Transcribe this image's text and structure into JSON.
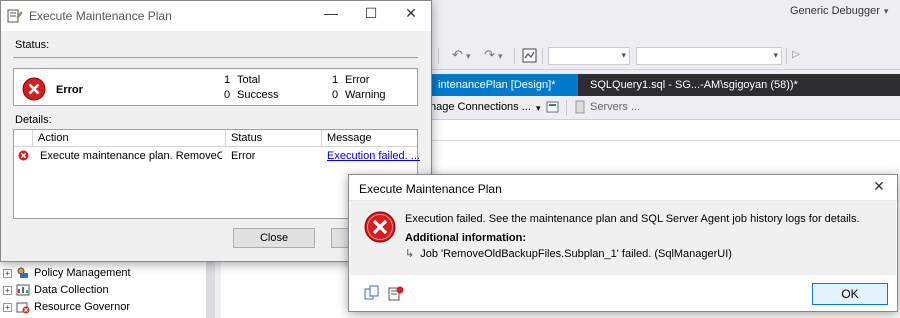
{
  "ssms": {
    "toolbar": {
      "undo_icon": "undo-icon",
      "redo_icon": "redo-icon",
      "debugger_label": "Generic Debugger"
    },
    "tabs": [
      {
        "label": "intenancePlan [Design]*"
      },
      {
        "label": "SQLQuery1.sql - SG...-AM\\sgigoyan (58))*"
      }
    ],
    "subtoolbar": {
      "manage_connections": "nage Connections ...",
      "servers": "Servers ..."
    },
    "tree": [
      {
        "label": "Policy Management",
        "icon": "policy-icon"
      },
      {
        "label": "Data Collection",
        "icon": "data-collection-icon"
      },
      {
        "label": "Resource Governor",
        "icon": "resource-governor-icon"
      }
    ],
    "colors": {
      "tab_bar": "#2d2d30",
      "tab_active": "#007acc"
    }
  },
  "execute_dialog": {
    "title": "Execute Maintenance Plan",
    "status_label": "Status:",
    "status": {
      "result": "Error",
      "total_count": "1",
      "total_label": "Total",
      "success_count": "0",
      "success_label": "Success",
      "error_count": "1",
      "error_label": "Error",
      "warning_count": "0",
      "warning_label": "Warning"
    },
    "details_label": "Details:",
    "columns": [
      "Action",
      "Status",
      "Message"
    ],
    "rows": [
      {
        "action": "Execute maintenance plan. RemoveOld...",
        "status": "Error",
        "message": "Execution failed. ..."
      }
    ],
    "close_label": "Close"
  },
  "error_dialog": {
    "title": "Execute Maintenance Plan",
    "message": "Execution failed. See the maintenance plan and SQL Server Agent job history logs for details.",
    "additional_label": "Additional information:",
    "detail": "Job 'RemoveOldBackupFiles.Subplan_1' failed. (SqlManagerUI)",
    "ok_label": "OK",
    "colors": {
      "error_icon": "#d21f1f",
      "ok_border": "#0078d7"
    }
  }
}
